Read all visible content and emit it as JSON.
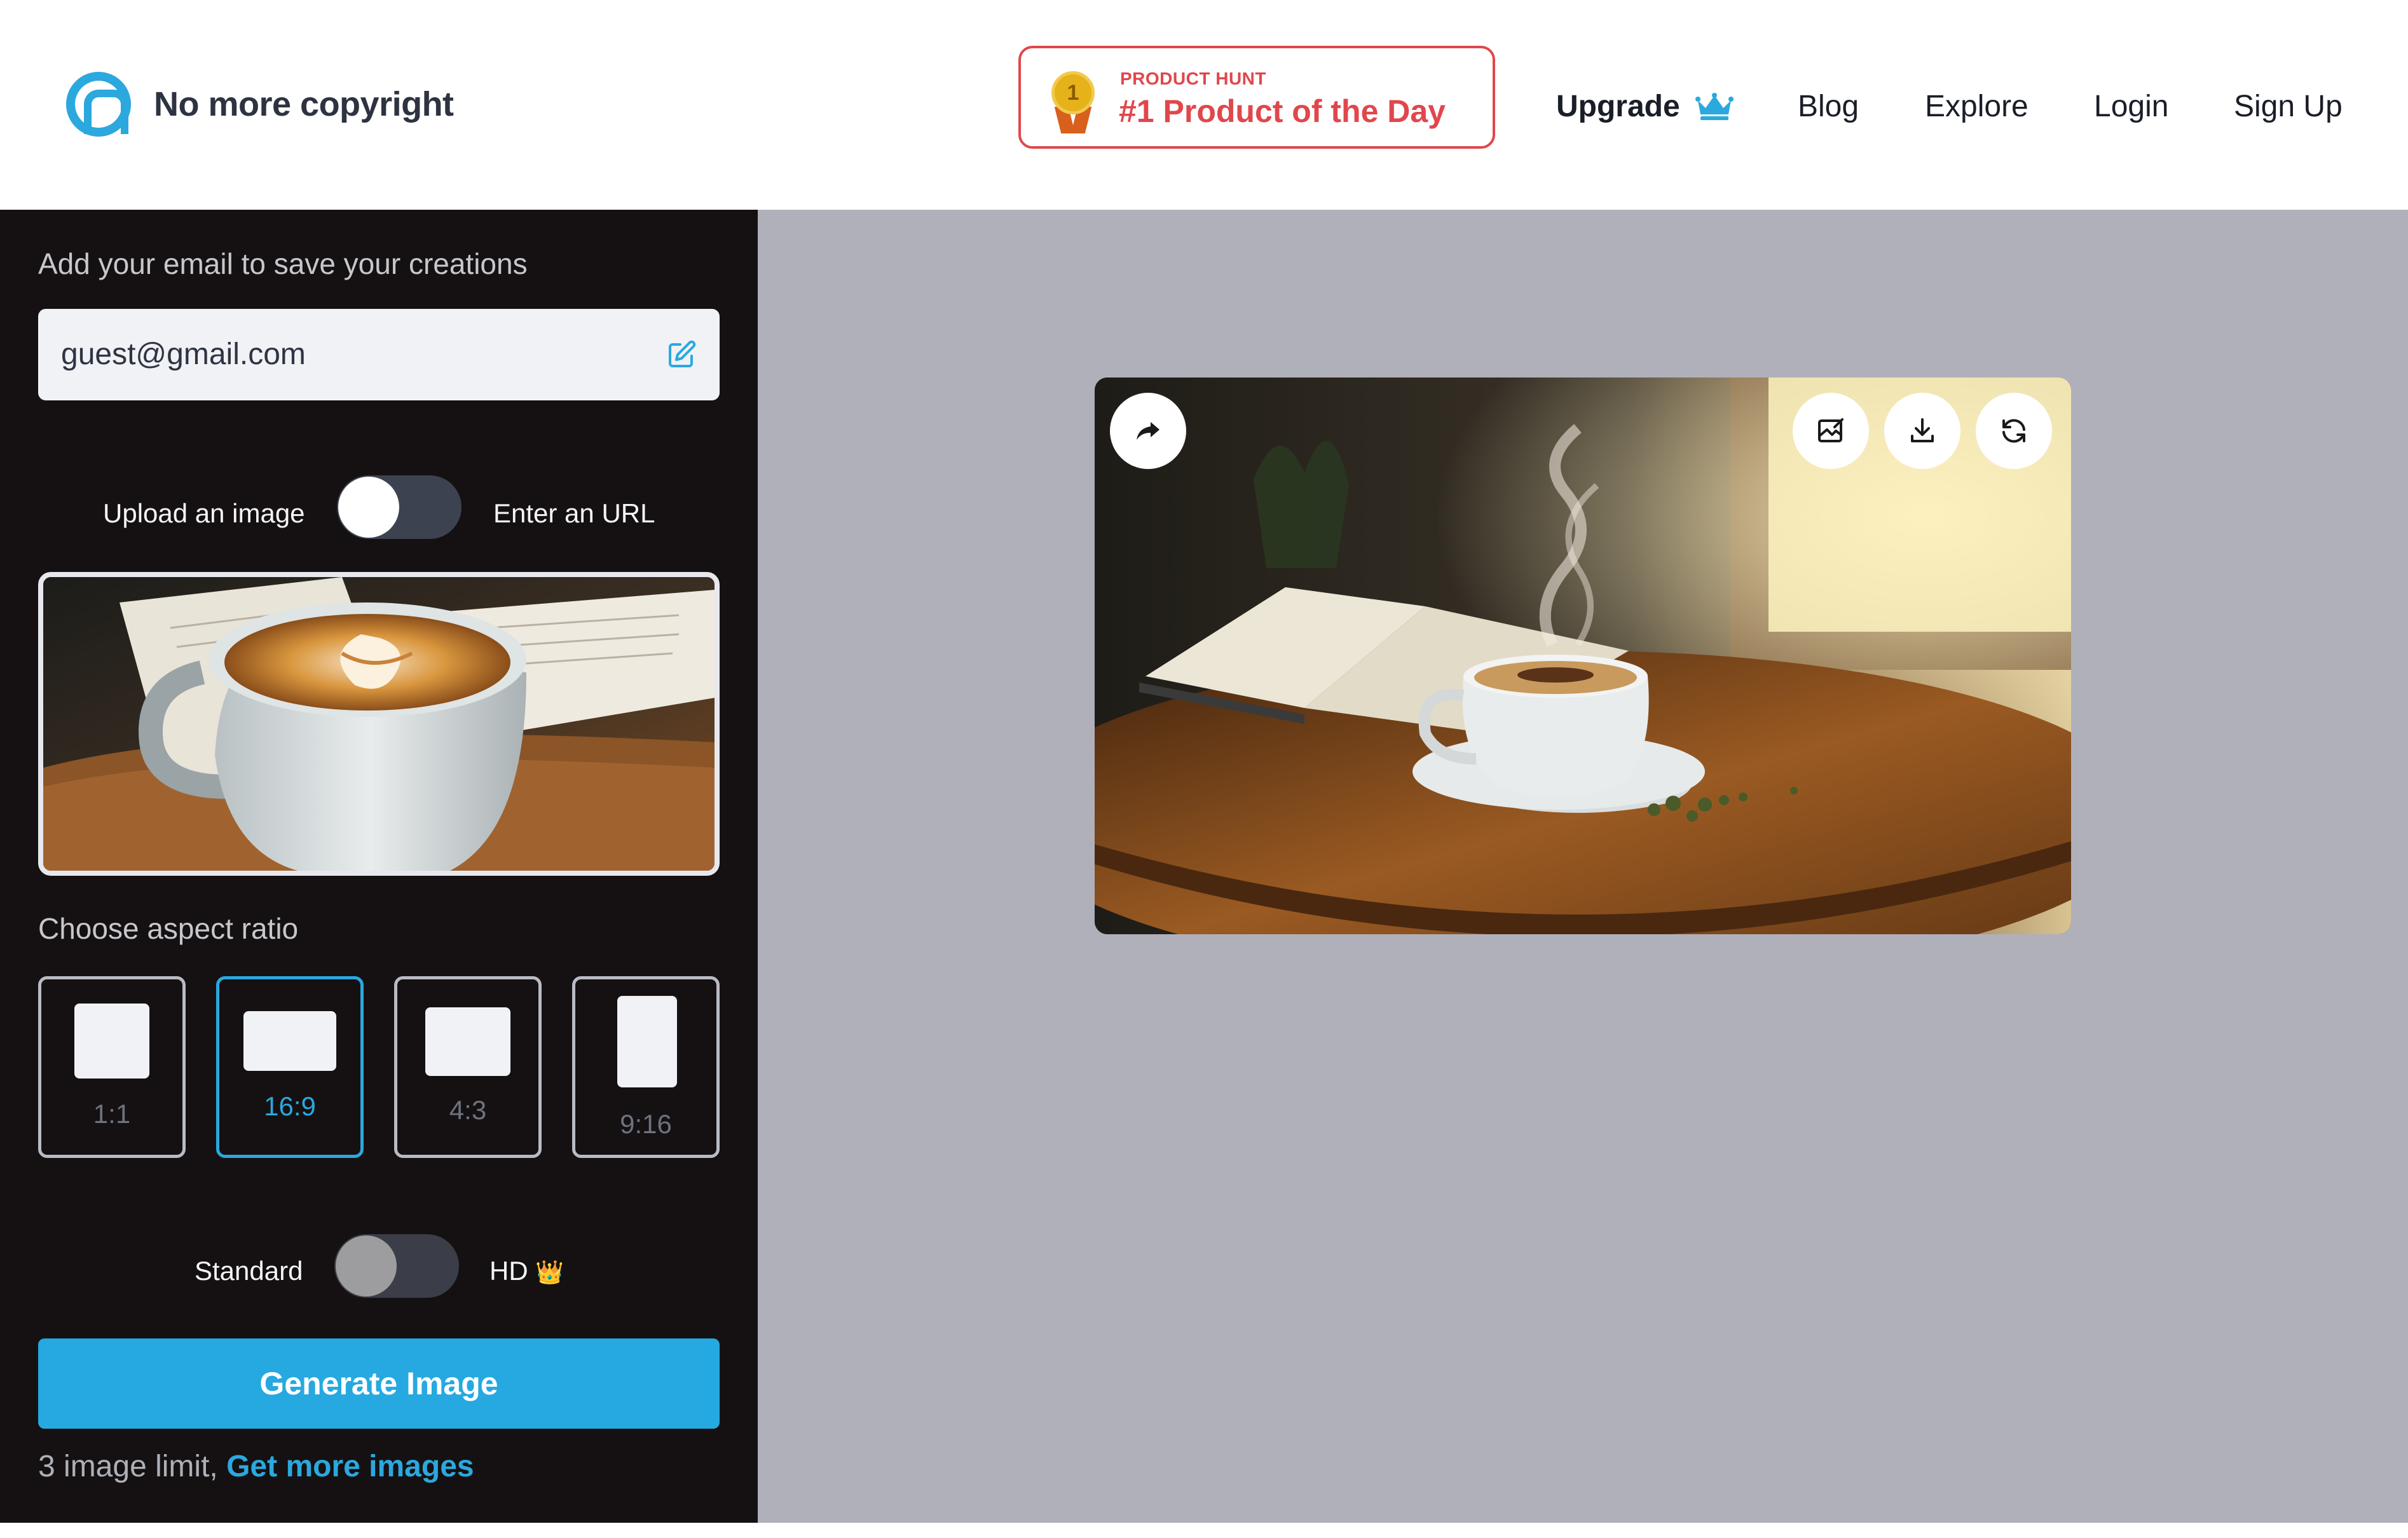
{
  "header": {
    "brand_name": "No more copyright",
    "badge": {
      "small": "PRODUCT HUNT",
      "big": "#1 Product of the Day",
      "medal_number": "1"
    },
    "nav": {
      "upgrade": "Upgrade",
      "blog": "Blog",
      "explore": "Explore",
      "login": "Login",
      "signup": "Sign Up"
    }
  },
  "sidebar": {
    "email_prompt": "Add your email to save your creations",
    "email_value": "guest@gmail.com",
    "source_toggle": {
      "left_label": "Upload an image",
      "right_label": "Enter an URL",
      "state": "upload"
    },
    "aspect_title": "Choose aspect ratio",
    "aspect_options": [
      "1:1",
      "16:9",
      "4:3",
      "9:16"
    ],
    "aspect_selected": "16:9",
    "quality_toggle": {
      "left_label": "Standard",
      "right_label": "HD",
      "right_emoji": "👑",
      "state": "standard"
    },
    "generate_label": "Generate Image",
    "limit_text": "3 image limit,",
    "limit_link": "Get more images"
  },
  "icons": {
    "brand": "brand-logo-icon",
    "medal": "medal-icon",
    "crown": "crown-icon",
    "edit": "edit-icon",
    "share": "share-icon",
    "edit_image": "edit-image-icon",
    "download": "download-icon",
    "regenerate": "refresh-icon"
  },
  "colors": {
    "accent": "#26a9e0",
    "badge_red": "#e0474c",
    "sidebar_bg": "#151112",
    "canvas_bg": "#b0b0ba"
  }
}
